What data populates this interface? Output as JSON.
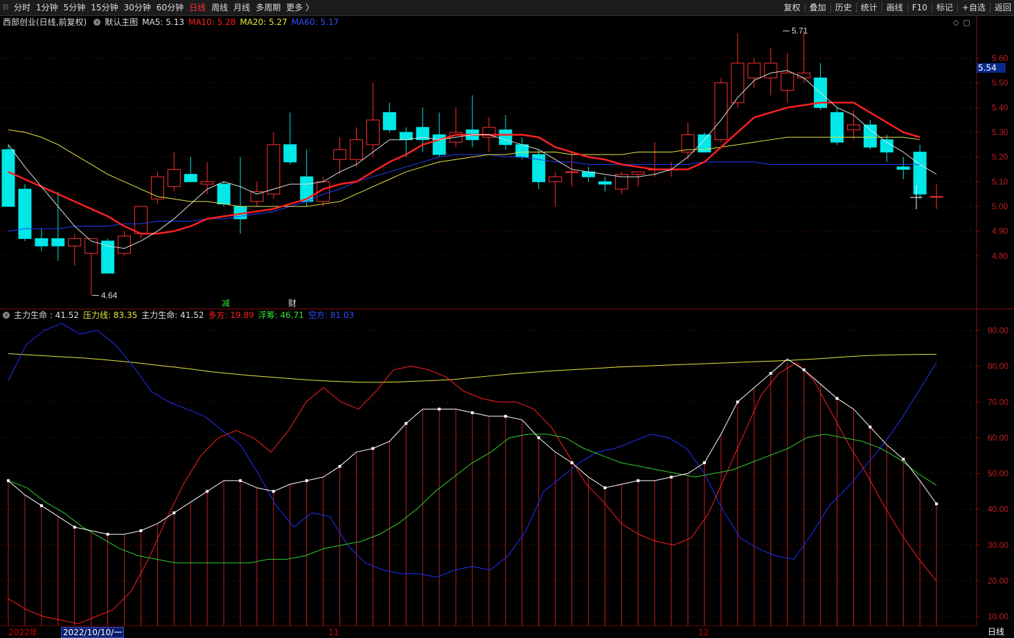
{
  "toolbar": {
    "corner": "ℿ",
    "periods": [
      "分时",
      "1分钟",
      "5分钟",
      "15分钟",
      "30分钟",
      "60分钟",
      "日线",
      "周线",
      "月线",
      "多周期",
      "更多 〉"
    ],
    "active_period": "日线",
    "tools": [
      "复权",
      "叠加",
      "历史",
      "统计",
      "画线",
      "F10",
      "标记",
      "+自选",
      "返回"
    ]
  },
  "main": {
    "stock_title": "西部创业(日线,前复权)",
    "template": "默认主图",
    "ma": [
      {
        "label": "MA5: 5.13",
        "color": "#e0e0e0"
      },
      {
        "label": "MA10: 5.28",
        "color": "#ff2020"
      },
      {
        "label": "MA20: 5.27",
        "color": "#e8e840"
      },
      {
        "label": "MA60: 5.17",
        "color": "#3050ff"
      }
    ],
    "high_label": "5.71",
    "low_label": "4.64",
    "last_price_tag": "5.54",
    "y_axis": [
      "5.60",
      "5.50",
      "5.40",
      "5.30",
      "5.20",
      "5.10",
      "5.00",
      "4.90",
      "4.80"
    ],
    "markers": [
      "减",
      "财"
    ],
    "top_icons": [
      "◇",
      "▢"
    ]
  },
  "indicator": {
    "title": "主力生命 : 41.52",
    "items": [
      {
        "label": "压力线: 83.35",
        "color": "#e8e840"
      },
      {
        "label": "主力生命: 41.52",
        "color": "#e0e0e0"
      },
      {
        "label": "多方: 19.89",
        "color": "#ff2020"
      },
      {
        "label": "浮筹: 46.71",
        "color": "#30e030"
      },
      {
        "label": "空方: 81.03",
        "color": "#3050ff"
      }
    ],
    "y_axis": [
      "90.00",
      "80.00",
      "70.00",
      "60.00",
      "50.00",
      "40.00",
      "30.00",
      "20.00",
      "10.00"
    ]
  },
  "date_axis": {
    "year_label": "2022年",
    "cursor_label": "2022/10/10/一",
    "month_11": "11",
    "month_12": "12"
  },
  "period_label": "日线",
  "chart_data": {
    "type": "candlestick",
    "candles": [
      {
        "o": 5.23,
        "h": 5.25,
        "l": 5.0,
        "c": 5.0
      },
      {
        "o": 5.07,
        "h": 5.09,
        "l": 4.86,
        "c": 4.87
      },
      {
        "o": 4.87,
        "h": 4.91,
        "l": 4.82,
        "c": 4.84
      },
      {
        "o": 4.87,
        "h": 5.06,
        "l": 4.78,
        "c": 4.84
      },
      {
        "o": 4.84,
        "h": 4.89,
        "l": 4.76,
        "c": 4.87
      },
      {
        "o": 4.81,
        "h": 4.87,
        "l": 4.64,
        "c": 4.87
      },
      {
        "o": 4.86,
        "h": 4.87,
        "l": 4.73,
        "c": 4.73
      },
      {
        "o": 4.81,
        "h": 4.9,
        "l": 4.8,
        "c": 4.88
      },
      {
        "o": 4.89,
        "h": 5.0,
        "l": 4.87,
        "c": 5.0
      },
      {
        "o": 5.03,
        "h": 5.14,
        "l": 5.01,
        "c": 5.12
      },
      {
        "o": 5.08,
        "h": 5.22,
        "l": 5.06,
        "c": 5.15
      },
      {
        "o": 5.13,
        "h": 5.2,
        "l": 5.1,
        "c": 5.1
      },
      {
        "o": 5.09,
        "h": 5.18,
        "l": 5.05,
        "c": 5.1
      },
      {
        "o": 5.09,
        "h": 5.1,
        "l": 5.0,
        "c": 5.01
      },
      {
        "o": 5.0,
        "h": 5.2,
        "l": 4.89,
        "c": 4.95
      },
      {
        "o": 5.02,
        "h": 5.1,
        "l": 5.0,
        "c": 5.06
      },
      {
        "o": 5.05,
        "h": 5.3,
        "l": 5.03,
        "c": 5.25
      },
      {
        "o": 5.25,
        "h": 5.38,
        "l": 5.17,
        "c": 5.18
      },
      {
        "o": 5.12,
        "h": 5.23,
        "l": 5.0,
        "c": 5.02
      },
      {
        "o": 5.02,
        "h": 5.12,
        "l": 5.0,
        "c": 5.1
      },
      {
        "o": 5.19,
        "h": 5.28,
        "l": 5.13,
        "c": 5.23
      },
      {
        "o": 5.19,
        "h": 5.32,
        "l": 5.16,
        "c": 5.27
      },
      {
        "o": 5.25,
        "h": 5.5,
        "l": 5.2,
        "c": 5.35
      },
      {
        "o": 5.38,
        "h": 5.42,
        "l": 5.3,
        "c": 5.31
      },
      {
        "o": 5.3,
        "h": 5.32,
        "l": 5.2,
        "c": 5.27
      },
      {
        "o": 5.32,
        "h": 5.4,
        "l": 5.22,
        "c": 5.27
      },
      {
        "o": 5.29,
        "h": 5.38,
        "l": 5.2,
        "c": 5.21
      },
      {
        "o": 5.26,
        "h": 5.4,
        "l": 5.24,
        "c": 5.3
      },
      {
        "o": 5.31,
        "h": 5.45,
        "l": 5.24,
        "c": 5.27
      },
      {
        "o": 5.28,
        "h": 5.36,
        "l": 5.22,
        "c": 5.32
      },
      {
        "o": 5.31,
        "h": 5.37,
        "l": 5.23,
        "c": 5.25
      },
      {
        "o": 5.25,
        "h": 5.28,
        "l": 5.19,
        "c": 5.2
      },
      {
        "o": 5.21,
        "h": 5.23,
        "l": 5.07,
        "c": 5.1
      },
      {
        "o": 5.1,
        "h": 5.14,
        "l": 5.0,
        "c": 5.12
      },
      {
        "o": 5.14,
        "h": 5.22,
        "l": 5.08,
        "c": 5.14
      },
      {
        "o": 5.14,
        "h": 5.16,
        "l": 5.1,
        "c": 5.12
      },
      {
        "o": 5.1,
        "h": 5.12,
        "l": 5.06,
        "c": 5.09
      },
      {
        "o": 5.07,
        "h": 5.14,
        "l": 5.05,
        "c": 5.13
      },
      {
        "o": 5.13,
        "h": 5.14,
        "l": 5.08,
        "c": 5.14
      },
      {
        "o": 5.15,
        "h": 5.26,
        "l": 5.12,
        "c": 5.15
      },
      {
        "o": 5.15,
        "h": 5.18,
        "l": 5.12,
        "c": 5.15
      },
      {
        "o": 5.22,
        "h": 5.34,
        "l": 5.19,
        "c": 5.29
      },
      {
        "o": 5.29,
        "h": 5.3,
        "l": 5.22,
        "c": 5.22
      },
      {
        "o": 5.27,
        "h": 5.52,
        "l": 5.26,
        "c": 5.5
      },
      {
        "o": 5.42,
        "h": 5.7,
        "l": 5.4,
        "c": 5.58
      },
      {
        "o": 5.52,
        "h": 5.6,
        "l": 5.48,
        "c": 5.58
      },
      {
        "o": 5.52,
        "h": 5.64,
        "l": 5.45,
        "c": 5.58
      },
      {
        "o": 5.47,
        "h": 5.62,
        "l": 5.42,
        "c": 5.54
      },
      {
        "o": 5.52,
        "h": 5.71,
        "l": 5.5,
        "c": 5.54
      },
      {
        "o": 5.52,
        "h": 5.58,
        "l": 5.39,
        "c": 5.4
      },
      {
        "o": 5.38,
        "h": 5.4,
        "l": 5.25,
        "c": 5.26
      },
      {
        "o": 5.31,
        "h": 5.39,
        "l": 5.27,
        "c": 5.33
      },
      {
        "o": 5.33,
        "h": 5.35,
        "l": 5.23,
        "c": 5.24
      },
      {
        "o": 5.27,
        "h": 5.29,
        "l": 5.18,
        "c": 5.22
      },
      {
        "o": 5.16,
        "h": 5.2,
        "l": 5.11,
        "c": 5.15
      },
      {
        "o": 5.22,
        "h": 5.25,
        "l": 5.03,
        "c": 5.05
      },
      {
        "o": 5.04,
        "h": 5.09,
        "l": 4.99,
        "c": 5.04
      }
    ],
    "ma5": [
      5.25,
      5.16,
      5.08,
      5.0,
      4.92,
      4.86,
      4.84,
      4.83,
      4.86,
      4.9,
      4.95,
      5.01,
      5.07,
      5.1,
      5.08,
      5.05,
      5.07,
      5.09,
      5.09,
      5.1,
      5.14,
      5.17,
      5.22,
      5.27,
      5.27,
      5.28,
      5.27,
      5.28,
      5.29,
      5.29,
      5.27,
      5.25,
      5.23,
      5.19,
      5.15,
      5.14,
      5.13,
      5.12,
      5.12,
      5.13,
      5.15,
      5.2,
      5.27,
      5.35,
      5.44,
      5.51,
      5.54,
      5.55,
      5.52,
      5.46,
      5.4,
      5.37,
      5.31,
      5.26,
      5.22,
      5.17,
      5.13
    ],
    "ma10": [
      5.14,
      5.11,
      5.08,
      5.05,
      5.02,
      4.99,
      4.96,
      4.92,
      4.89,
      4.89,
      4.9,
      4.92,
      4.95,
      4.96,
      4.97,
      4.98,
      4.99,
      5.01,
      5.03,
      5.07,
      5.09,
      5.1,
      5.14,
      5.18,
      5.21,
      5.25,
      5.27,
      5.29,
      5.29,
      5.29,
      5.29,
      5.29,
      5.28,
      5.24,
      5.22,
      5.2,
      5.19,
      5.17,
      5.16,
      5.15,
      5.15,
      5.15,
      5.18,
      5.24,
      5.3,
      5.36,
      5.38,
      5.4,
      5.41,
      5.42,
      5.42,
      5.42,
      5.38,
      5.34,
      5.3,
      5.28
    ],
    "ma20": [
      5.31,
      5.3,
      5.28,
      5.25,
      5.21,
      5.17,
      5.13,
      5.1,
      5.07,
      5.04,
      5.03,
      5.02,
      5.02,
      5.01,
      5.0,
      5.0,
      5.0,
      5.0,
      5.0,
      5.01,
      5.02,
      5.05,
      5.08,
      5.11,
      5.14,
      5.16,
      5.18,
      5.19,
      5.2,
      5.21,
      5.21,
      5.22,
      5.22,
      5.22,
      5.21,
      5.21,
      5.21,
      5.21,
      5.22,
      5.22,
      5.22,
      5.23,
      5.23,
      5.24,
      5.25,
      5.26,
      5.27,
      5.28,
      5.28,
      5.28,
      5.28,
      5.28,
      5.28,
      5.28,
      5.28,
      5.27
    ],
    "ma60": [
      4.9,
      4.91,
      4.91,
      4.91,
      4.92,
      4.92,
      4.92,
      4.93,
      4.93,
      4.94,
      4.94,
      4.94,
      4.95,
      4.95,
      4.96,
      4.97,
      4.98,
      5.0,
      5.02,
      5.05,
      5.07,
      5.1,
      5.12,
      5.14,
      5.16,
      5.18,
      5.2,
      5.21,
      5.21,
      5.21,
      5.2,
      5.2,
      5.19,
      5.18,
      5.18,
      5.17,
      5.17,
      5.17,
      5.17,
      5.17,
      5.17,
      5.17,
      5.18,
      5.18,
      5.18,
      5.18,
      5.17,
      5.17,
      5.17,
      5.17,
      5.17,
      5.17,
      5.17,
      5.17,
      5.17,
      5.17
    ],
    "main_life": [
      48,
      44,
      41,
      38,
      35,
      34,
      33,
      33,
      34,
      36,
      39,
      42,
      45,
      48,
      48,
      46,
      45,
      47,
      48,
      49,
      52,
      56,
      57,
      59,
      64,
      68,
      68,
      68,
      67,
      66,
      66,
      65,
      60,
      56,
      53,
      49,
      46,
      47,
      48,
      48,
      49,
      50,
      53,
      61,
      70,
      74,
      78,
      82,
      79,
      75,
      71,
      68,
      63,
      58,
      54,
      48,
      41.5
    ],
    "pressure": [
      83.5,
      83.2,
      82.9,
      82.6,
      82.3,
      81.9,
      81.4,
      80.9,
      80.3,
      79.7,
      79.1,
      78.4,
      77.9,
      77.4,
      77.0,
      76.6,
      76.2,
      75.9,
      75.7,
      75.5,
      75.5,
      75.6,
      75.8,
      76.0,
      76.3,
      76.8,
      77.3,
      77.8,
      78.2,
      78.6,
      78.9,
      79.2,
      79.5,
      79.8,
      80.0,
      80.2,
      80.4,
      80.6,
      80.8,
      81.0,
      81.2,
      81.4,
      81.6,
      81.9,
      82.2,
      82.6,
      82.9,
      83.1,
      83.2,
      83.3,
      83.35
    ],
    "bull": [
      15,
      12,
      10,
      9,
      8,
      10,
      12,
      17,
      26,
      37,
      47,
      55,
      60,
      62,
      60,
      56,
      62,
      70,
      74,
      70,
      68,
      73,
      79,
      80,
      79,
      77,
      73,
      71,
      70,
      70,
      68,
      63,
      55,
      47,
      42,
      36,
      33,
      31,
      30,
      32,
      39,
      50,
      61,
      72,
      78,
      81,
      76,
      67,
      58,
      50,
      41,
      33,
      26,
      19.9
    ],
    "float": [
      48,
      46,
      42,
      39,
      35,
      32,
      29,
      27,
      26,
      25,
      25,
      25,
      25,
      25,
      26,
      26,
      27,
      29,
      30,
      31,
      33,
      36,
      40,
      45,
      49,
      53,
      56,
      60,
      61,
      61,
      60,
      57,
      55,
      53,
      52,
      51,
      50,
      49,
      50,
      51,
      53,
      55,
      57,
      60,
      61,
      60,
      59,
      57,
      54,
      50,
      46.7
    ],
    "bear": [
      76,
      86,
      90,
      92,
      89,
      90,
      86,
      80,
      73,
      70,
      68,
      66,
      62,
      58,
      50,
      41,
      35,
      39,
      38,
      30,
      25,
      23,
      22,
      22,
      21,
      23,
      24,
      23,
      27,
      34,
      45,
      49,
      53,
      56,
      57,
      59,
      61,
      60,
      57,
      50,
      40,
      32,
      29,
      27,
      26,
      33,
      41,
      46,
      52,
      58,
      65,
      73,
      81.03
    ]
  }
}
